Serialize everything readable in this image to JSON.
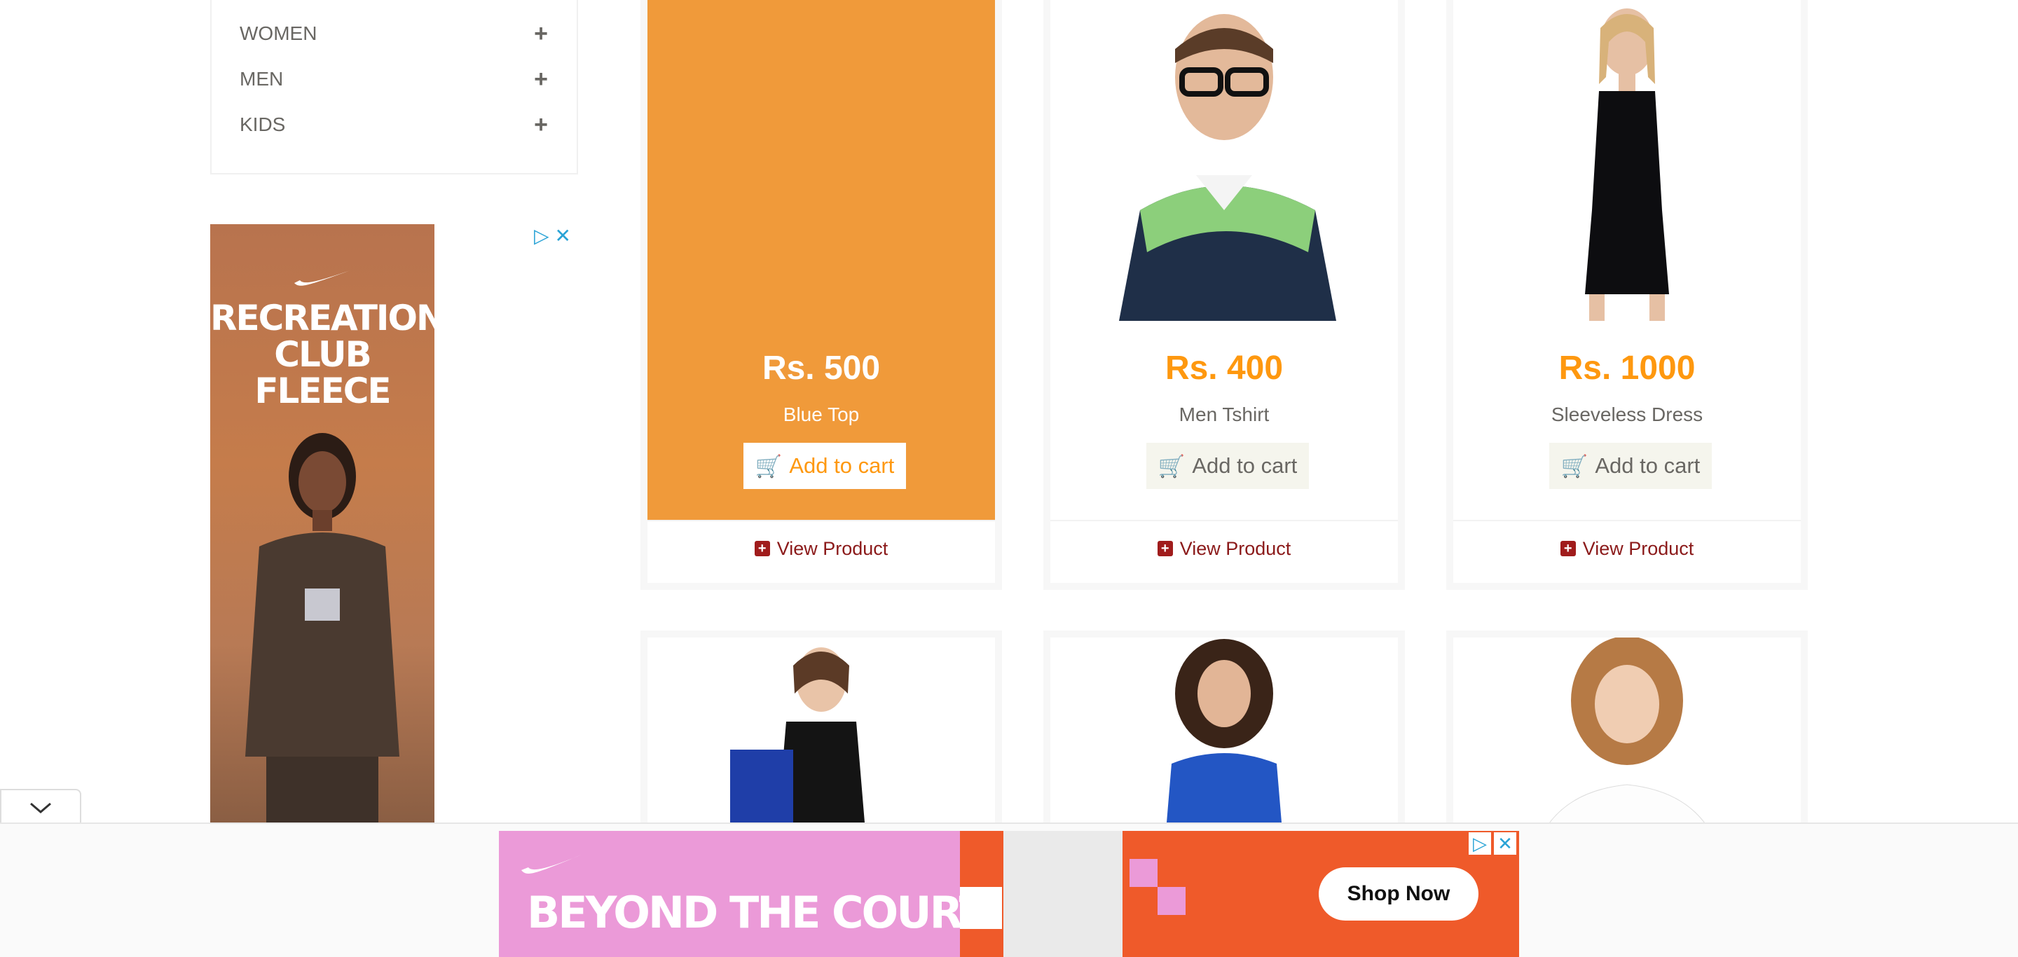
{
  "sidebar": {
    "categories": [
      {
        "label": "WOMEN",
        "icon": "plus-icon"
      },
      {
        "label": "MEN",
        "icon": "plus-icon"
      },
      {
        "label": "KIDS",
        "icon": "plus-icon"
      }
    ]
  },
  "side_ad": {
    "headline_line1": "RECREATION",
    "headline_line2": "CLUB FLEECE",
    "brand_icon": "swoosh-logo",
    "choices_icons": [
      "adchoices-icon",
      "close-icon"
    ]
  },
  "products": [
    {
      "price": "Rs. 500",
      "name": "Blue Top",
      "cart_label": "Add to cart",
      "view_label": "View Product",
      "highlighted": true
    },
    {
      "price": "Rs. 400",
      "name": "Men Tshirt",
      "cart_label": "Add to cart",
      "view_label": "View Product",
      "highlighted": false
    },
    {
      "price": "Rs. 1000",
      "name": "Sleeveless Dress",
      "cart_label": "Add to cart",
      "view_label": "View Product",
      "highlighted": false
    }
  ],
  "bottom_ad": {
    "headline": "BEYOND THE COURT",
    "button_label": "Shop Now",
    "brand_icon": "swoosh-logo",
    "choices_icons": [
      "adchoices-icon",
      "close-icon"
    ]
  },
  "colors": {
    "price_orange": "#fe980f",
    "highlight_bg": "#f09a3a",
    "view_link": "#8b1a1a",
    "side_ad_bg": "#c57c4b",
    "banner_pink": "#eb9ad8",
    "banner_orange": "#ef5a2a"
  }
}
